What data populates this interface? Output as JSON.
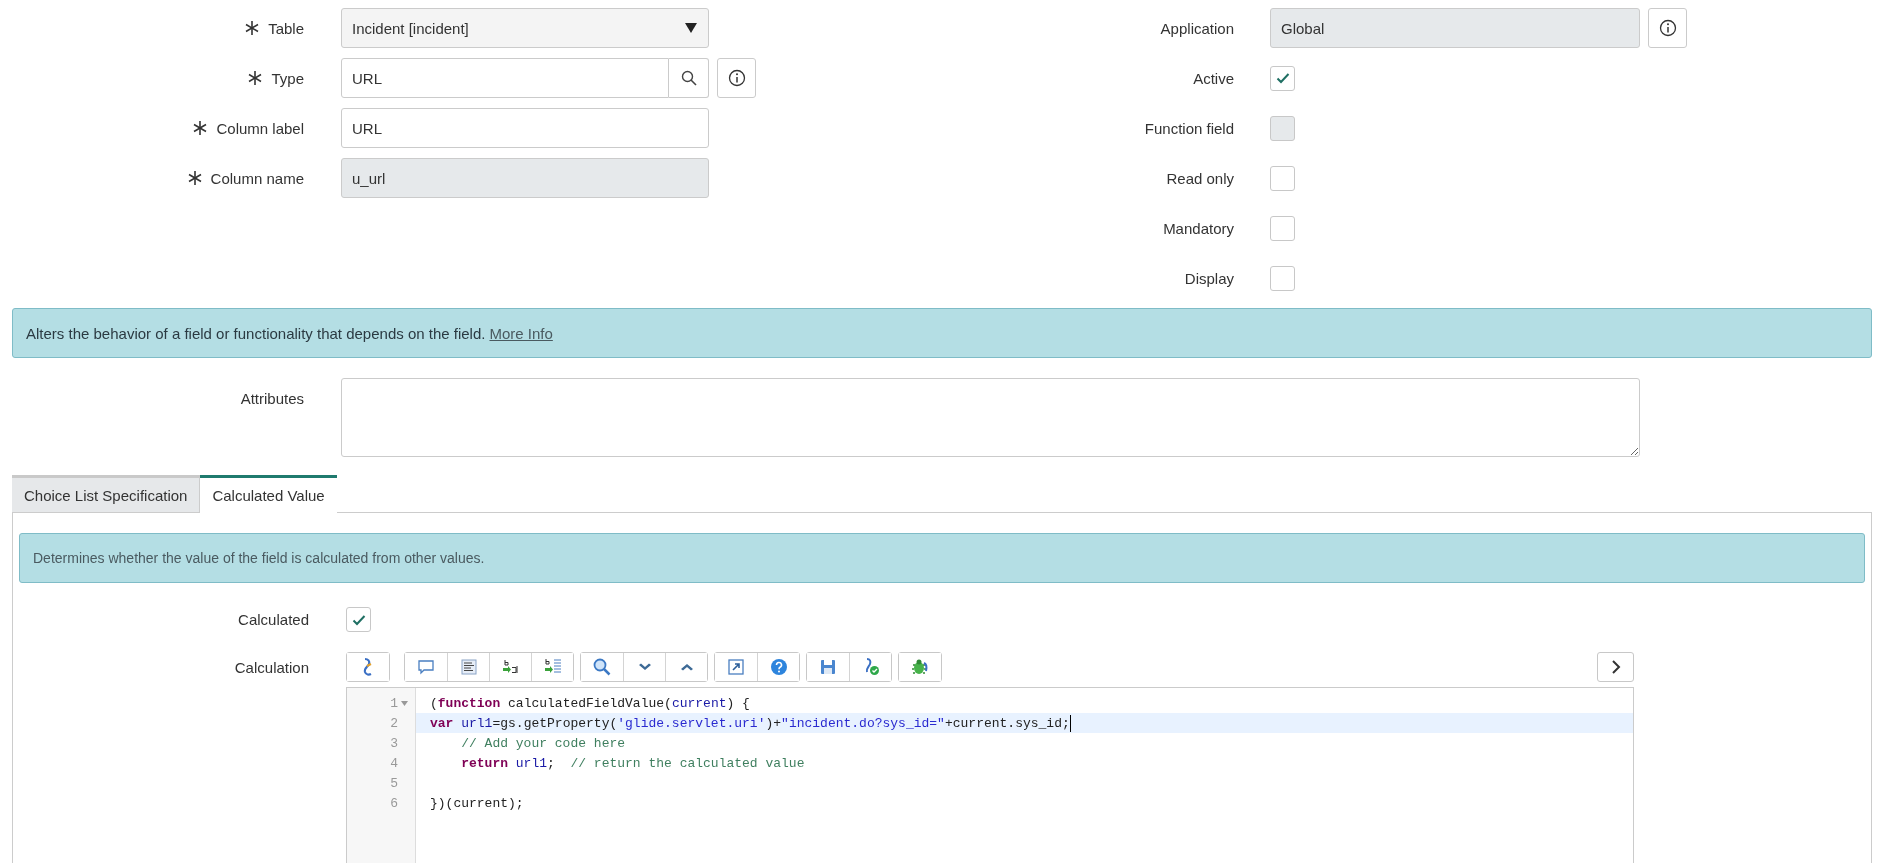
{
  "left_fields": [
    {
      "label": "Table",
      "required": true,
      "kind": "select",
      "value": "Incident [incident]"
    },
    {
      "label": "Type",
      "required": true,
      "kind": "reference",
      "value": "URL"
    },
    {
      "label": "Column label",
      "required": true,
      "kind": "text",
      "value": "URL"
    },
    {
      "label": "Column name",
      "required": true,
      "kind": "readonly",
      "value": "u_url"
    }
  ],
  "right_fields": [
    {
      "label": "Application",
      "kind": "readonly-info",
      "value": "Global"
    },
    {
      "label": "Active",
      "kind": "checkbox",
      "checked": true,
      "disabled": false
    },
    {
      "label": "Function field",
      "kind": "checkbox",
      "checked": false,
      "disabled": true
    },
    {
      "label": "Read only",
      "kind": "checkbox",
      "checked": false,
      "disabled": false
    },
    {
      "label": "Mandatory",
      "kind": "checkbox",
      "checked": false,
      "disabled": false
    },
    {
      "label": "Display",
      "kind": "checkbox",
      "checked": false,
      "disabled": false
    }
  ],
  "info_banner": {
    "text": "Alters the behavior of a field or functionality that depends on the field.",
    "link": "More Info"
  },
  "attributes": {
    "label": "Attributes"
  },
  "tabs": [
    {
      "label": "Choice List Specification",
      "selected": false
    },
    {
      "label": "Calculated Value",
      "selected": true
    }
  ],
  "tab_panel": {
    "banner": "Determines whether the value of the field is calculated from other values.",
    "calculated": {
      "label": "Calculated",
      "checked": true
    },
    "calculation": {
      "label": "Calculation",
      "toolbar": [
        [
          {
            "kind": "script"
          }
        ],
        [
          {
            "kind": "comment"
          },
          {
            "kind": "format"
          },
          {
            "kind": "replace"
          },
          {
            "kind": "replace-all"
          }
        ],
        [
          {
            "kind": "search"
          },
          {
            "kind": "down"
          },
          {
            "kind": "up"
          }
        ],
        [
          {
            "kind": "fullscreen"
          },
          {
            "kind": "help"
          }
        ],
        [
          {
            "kind": "save"
          },
          {
            "kind": "validate"
          }
        ],
        [
          {
            "kind": "debug"
          }
        ]
      ],
      "lines": [
        {
          "number": "1",
          "foldable": true,
          "active": false,
          "tokens": [
            {
              "kind": "plain",
              "text": "("
            },
            {
              "kind": "keyword",
              "text": "function"
            },
            {
              "kind": "plain",
              "text": " calculatedFieldValue("
            },
            {
              "kind": "variable",
              "text": "current"
            },
            {
              "kind": "plain",
              "text": ") {"
            }
          ]
        },
        {
          "number": "2",
          "foldable": false,
          "active": true,
          "tokens": [
            {
              "kind": "keyword",
              "text": "var"
            },
            {
              "kind": "variable",
              "text": " url1"
            },
            {
              "kind": "plain",
              "text": "=gs.getProperty("
            },
            {
              "kind": "string",
              "text": "'glide.servlet.uri'"
            },
            {
              "kind": "plain",
              "text": ")+"
            },
            {
              "kind": "string",
              "text": "\"incident.do?sys_id=\""
            },
            {
              "kind": "plain",
              "text": "+current.sys_id;"
            }
          ]
        },
        {
          "number": "3",
          "foldable": false,
          "active": false,
          "tokens": [
            {
              "kind": "comment",
              "text": "    // Add your code here"
            }
          ]
        },
        {
          "number": "4",
          "foldable": false,
          "active": false,
          "tokens": [
            {
              "kind": "keyword",
              "text": "    return"
            },
            {
              "kind": "variable",
              "text": " url1"
            },
            {
              "kind": "plain",
              "text": ";  "
            },
            {
              "kind": "comment",
              "text": "// return the calculated value"
            }
          ]
        },
        {
          "number": "5",
          "foldable": false,
          "active": false
        },
        {
          "number": "6",
          "foldable": false,
          "active": false,
          "tokens": [
            {
              "kind": "plain",
              "text": "})(current);"
            }
          ]
        }
      ]
    }
  }
}
